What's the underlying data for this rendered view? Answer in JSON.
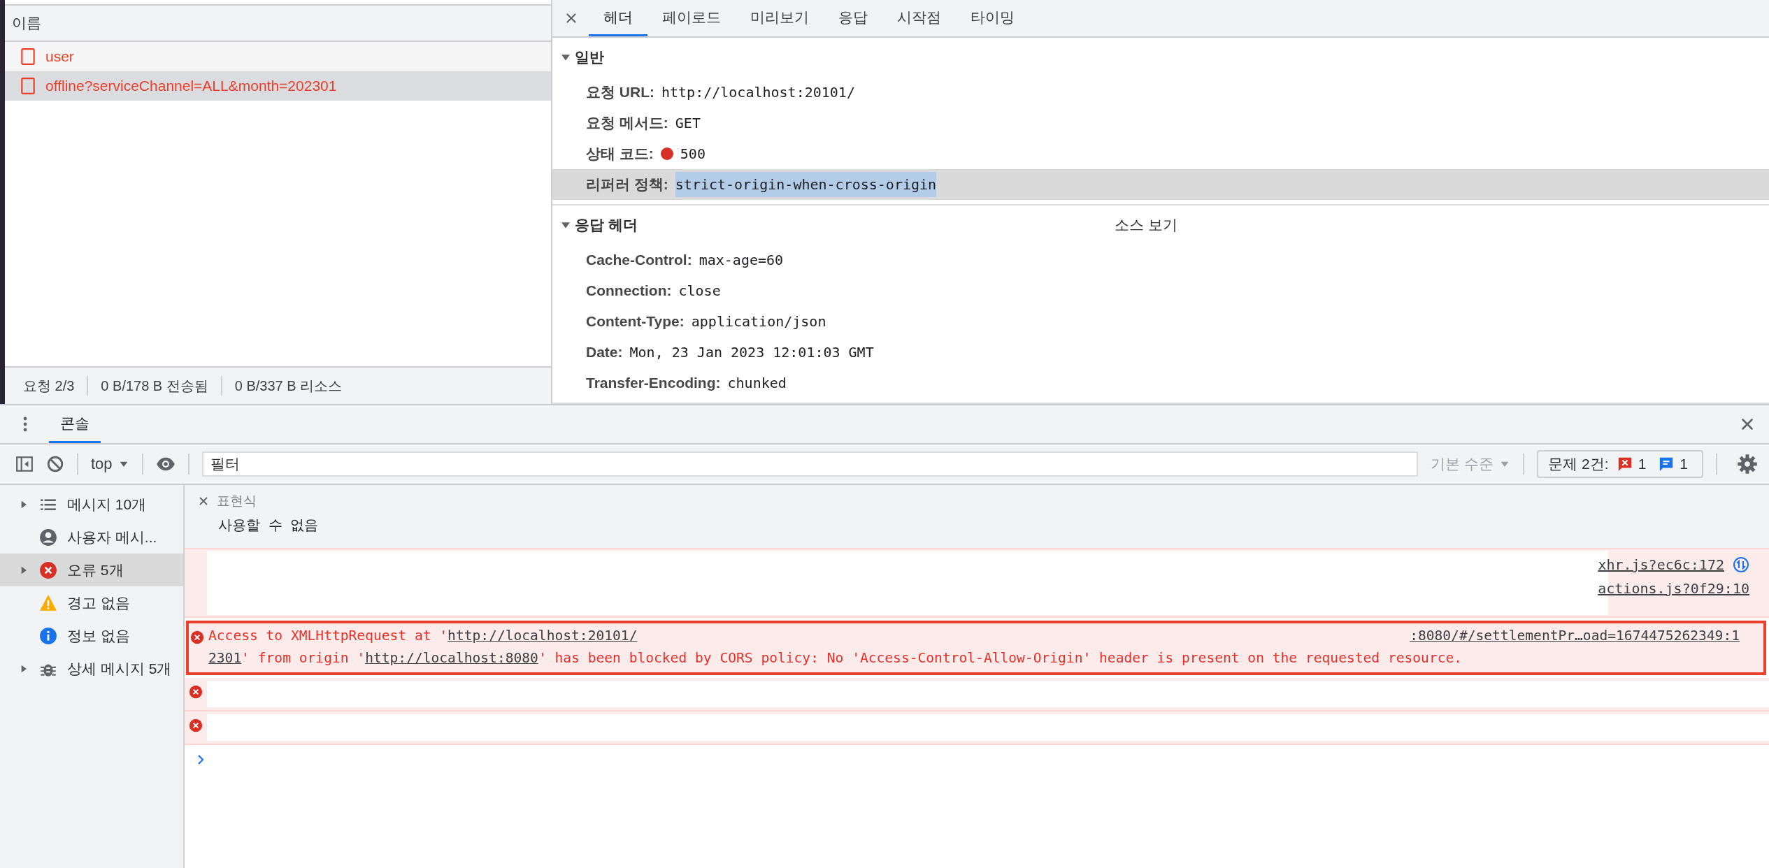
{
  "network": {
    "name_column": "이름",
    "requests": [
      {
        "name": "user",
        "selected": false,
        "failed": true
      },
      {
        "name": "offline?serviceChannel=ALL&month=202301",
        "selected": true,
        "failed": true
      }
    ],
    "summary": [
      "요청 2/3",
      "0 B/178 B 전송됨",
      "0 B/337 B 리소스"
    ]
  },
  "details": {
    "tabs": [
      {
        "label": "헤더",
        "selected": true
      },
      {
        "label": "페이로드",
        "selected": false
      },
      {
        "label": "미리보기",
        "selected": false
      },
      {
        "label": "응답",
        "selected": false
      },
      {
        "label": "시작점",
        "selected": false
      },
      {
        "label": "타이밍",
        "selected": false
      }
    ],
    "sections": [
      {
        "title": "일반",
        "expanded": true,
        "rows": [
          {
            "label": "요청 URL:",
            "value": "http://localhost:20101/",
            "selected": false
          },
          {
            "label": "요청 메서드:",
            "value": "GET",
            "selected": false
          },
          {
            "label": "상태 코드:",
            "value": "500",
            "color": "#d93025",
            "selected": false
          },
          {
            "label": "리퍼러 정책:",
            "value": "strict-origin-when-cross-origin",
            "selected": true
          }
        ]
      },
      {
        "title": "응답 헤더",
        "expanded": true,
        "action": "소스 보기",
        "rows": [
          {
            "label": "Cache-Control:",
            "value": "max-age=60",
            "selected": false
          },
          {
            "label": "Connection:",
            "value": "close",
            "selected": false
          },
          {
            "label": "Content-Type:",
            "value": "application/json",
            "selected": false
          },
          {
            "label": "Date:",
            "value": "Mon, 23 Jan 2023 12:01:03 GMT",
            "selected": false
          },
          {
            "label": "Transfer-Encoding:",
            "value": "chunked",
            "selected": false
          }
        ]
      }
    ]
  },
  "console": {
    "tabs": [
      {
        "label": "콘솔",
        "selected": true
      }
    ],
    "context": "top",
    "filter": {
      "placeholder": "필터"
    },
    "level_menu": "기본 수준",
    "issues": {
      "label": "문제 2건:",
      "errors": "1",
      "infos": "1"
    },
    "sidebar": [
      {
        "kind": "list",
        "label": "메시지 10개",
        "expandable": true,
        "selected": false
      },
      {
        "kind": "user",
        "label": "사용자 메시...",
        "expandable": false,
        "selected": false
      },
      {
        "kind": "error",
        "label": "오류 5개",
        "expandable": true,
        "selected": true
      },
      {
        "kind": "warning",
        "label": "경고 없음",
        "expandable": false,
        "selected": false
      },
      {
        "kind": "info",
        "label": "정보 없음",
        "expandable": false,
        "selected": false
      },
      {
        "kind": "verbose",
        "label": "상세 메시지 5개",
        "expandable": true,
        "selected": false
      }
    ],
    "expression": {
      "label": "표현식",
      "value": "사용할 수 없음"
    },
    "messages": [
      {
        "icon": false,
        "highlighted": false,
        "redacted": true,
        "sources": [
          {
            "text": "xhr.js?ec6c:172",
            "network_icon": true
          },
          {
            "text": "actions.js?0f29:10",
            "network_icon": false
          }
        ]
      },
      {
        "icon": true,
        "highlighted": true,
        "redacted": false,
        "lines": [
          [
            {
              "kind": "text",
              "text": "Access to XMLHttpRequest at '"
            },
            {
              "kind": "link",
              "text": "http://localhost:20101/"
            },
            {
              "kind": "source",
              "text": ":8080/#/settlementPr…oad=1674475262349:1"
            }
          ],
          [
            {
              "kind": "link",
              "text": "2301"
            },
            {
              "kind": "text",
              "text": "' from origin '"
            },
            {
              "kind": "link",
              "text": "http://localhost:8080"
            },
            {
              "kind": "text",
              "text": "' has been blocked by CORS policy: No 'Access-Control-Allow-Origin' header is present on the requested resource."
            }
          ]
        ]
      },
      {
        "icon": true,
        "highlighted": false,
        "redacted": true
      },
      {
        "icon": true,
        "highlighted": false,
        "redacted": true
      }
    ]
  }
}
